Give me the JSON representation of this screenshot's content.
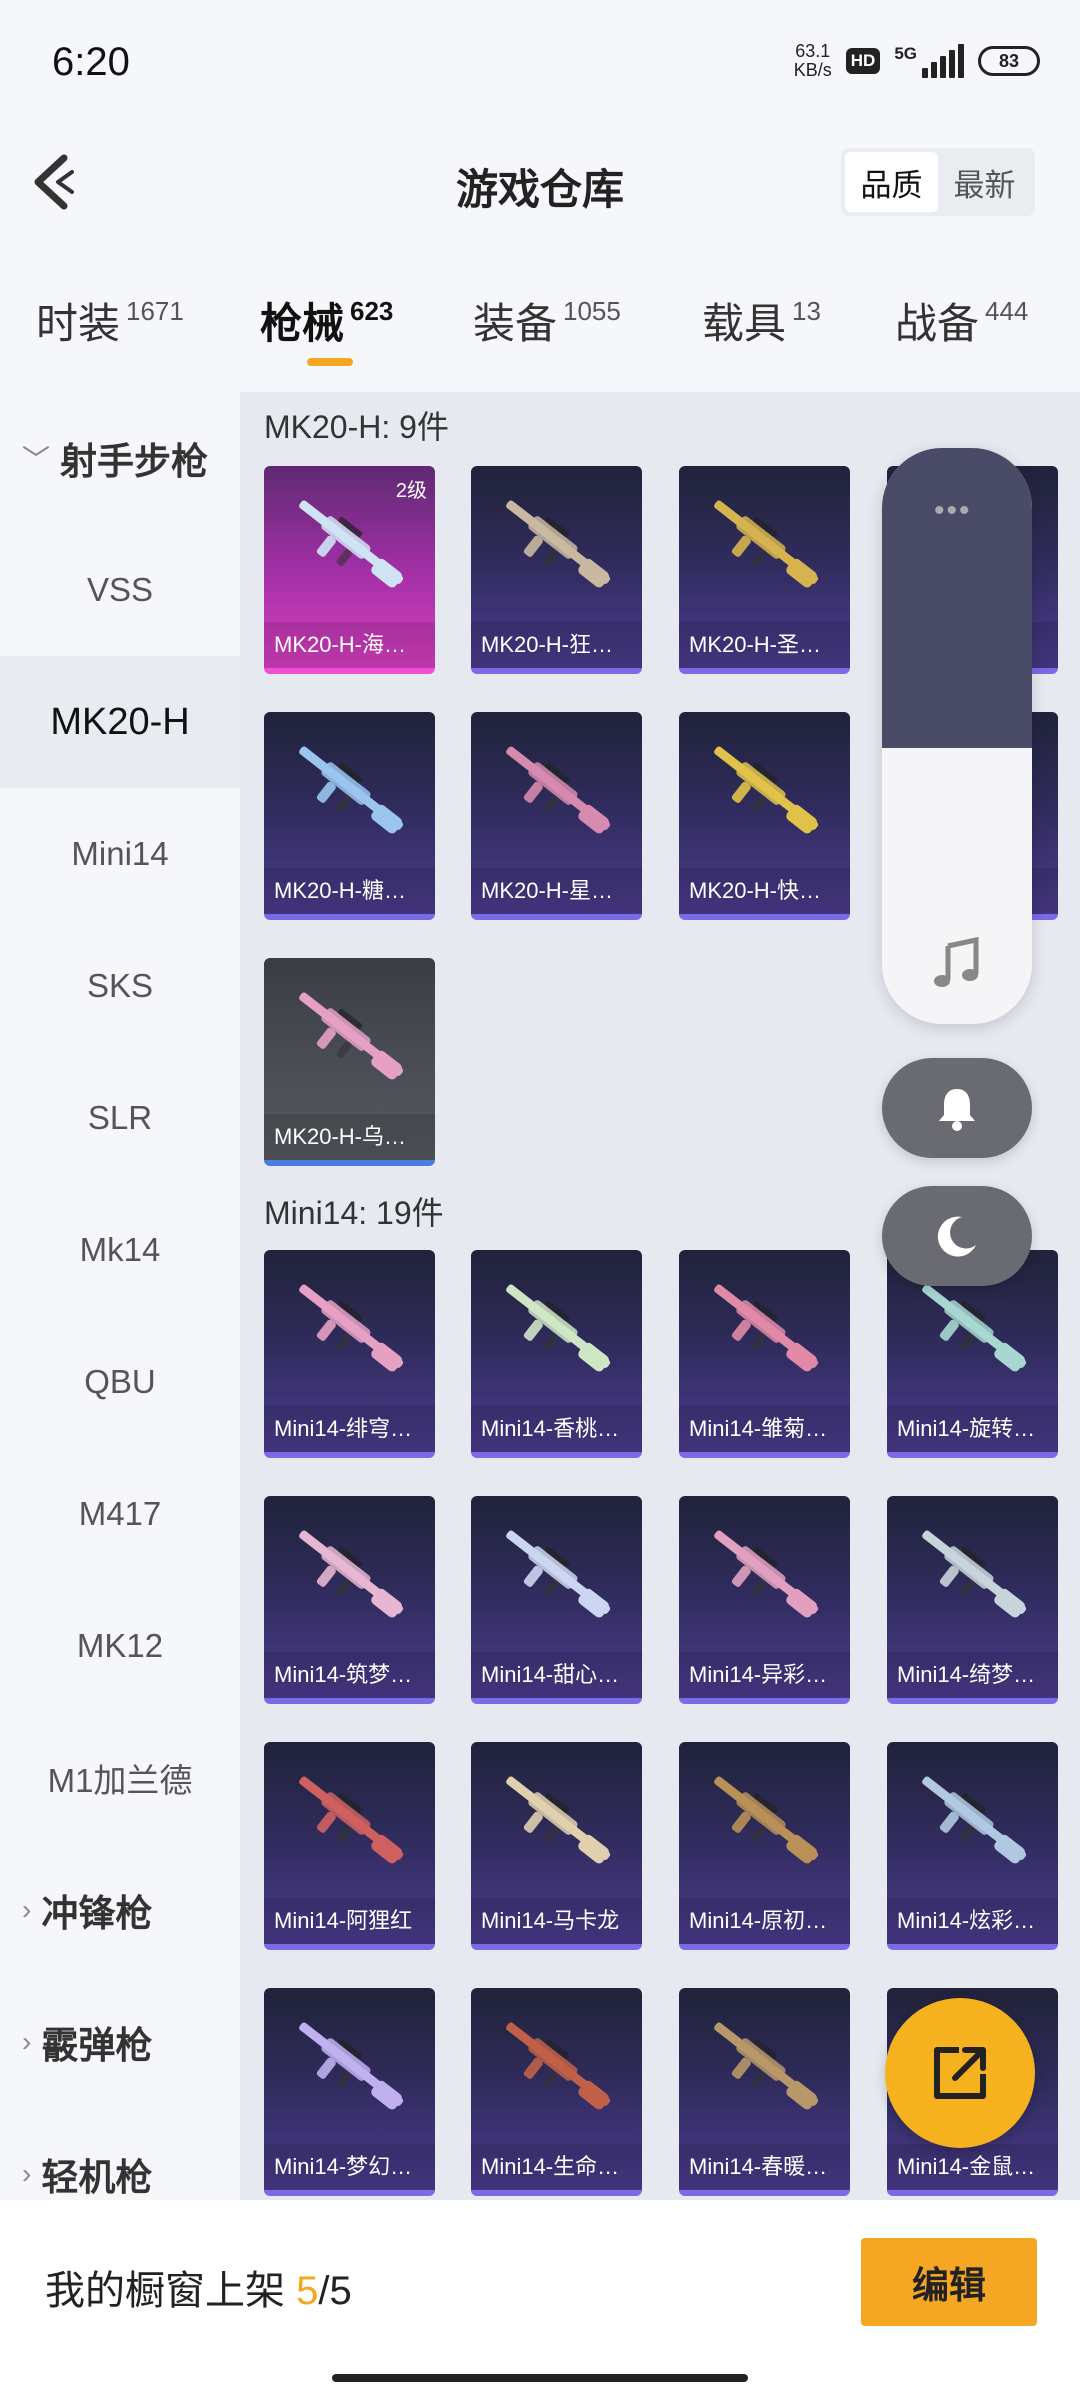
{
  "status": {
    "time": "6:20",
    "net_speed": "63.1",
    "net_unit": "KB/s",
    "hd": "HD",
    "network": "5G",
    "battery": "83"
  },
  "header": {
    "title": "游戏仓库",
    "sort_options": [
      "品质",
      "最新"
    ],
    "sort_selected": "品质"
  },
  "tabs": [
    {
      "label": "时装",
      "count": "1671"
    },
    {
      "label": "枪械",
      "count": "623",
      "active": true
    },
    {
      "label": "装备",
      "count": "1055"
    },
    {
      "label": "载具",
      "count": "13"
    },
    {
      "label": "战备",
      "count": "444"
    }
  ],
  "sidebar": {
    "category_open": "射手步枪",
    "items": [
      "VSS",
      "MK20-H",
      "Mini14",
      "SKS",
      "SLR",
      "Mk14",
      "QBU",
      "M417",
      "MK12",
      "M1加兰德"
    ],
    "selected": "MK20-H",
    "collapsed_categories": [
      "冲锋枪",
      "霰弹枪",
      "轻机枪"
    ]
  },
  "sections": [
    {
      "title": "MK20-H: 9件",
      "items": [
        {
          "name": "MK20-H-海…",
          "badge": "2级",
          "style": "pink"
        },
        {
          "name": "MK20-H-狂…",
          "style": "purple"
        },
        {
          "name": "MK20-H-圣…",
          "style": "purple"
        },
        {
          "name": "",
          "style": "purple"
        },
        {
          "name": "MK20-H-糖…",
          "style": "purple"
        },
        {
          "name": "MK20-H-星…",
          "style": "purple"
        },
        {
          "name": "MK20-H-快…",
          "style": "purple"
        },
        {
          "name": "",
          "style": "purple"
        },
        {
          "name": "MK20-H-乌…",
          "style": "gray"
        }
      ]
    },
    {
      "title": "Mini14: 19件",
      "items": [
        {
          "name": "Mini14-绯穹…"
        },
        {
          "name": "Mini14-香桃…"
        },
        {
          "name": "Mini14-雏菊…"
        },
        {
          "name": "Mini14-旋转…"
        },
        {
          "name": "Mini14-筑梦…"
        },
        {
          "name": "Mini14-甜心…"
        },
        {
          "name": "Mini14-异彩…"
        },
        {
          "name": "Mini14-绮梦…"
        },
        {
          "name": "Mini14-阿狸红"
        },
        {
          "name": "Mini14-马卡龙"
        },
        {
          "name": "Mini14-原初…"
        },
        {
          "name": "Mini14-炫彩…"
        },
        {
          "name": "Mini14-梦幻…"
        },
        {
          "name": "Mini14-生命…"
        },
        {
          "name": "Mini14-春暖…"
        },
        {
          "name": "Mini14-金鼠…"
        }
      ]
    }
  ],
  "bottom": {
    "label": "我的橱窗上架",
    "current": "5",
    "total": "/5",
    "edit_label": "编辑"
  },
  "colors": {
    "accent": "#f5a623",
    "card_purple": "#4b3b8e",
    "card_pink": "#d93fc2",
    "card_gray": "#55585f"
  }
}
